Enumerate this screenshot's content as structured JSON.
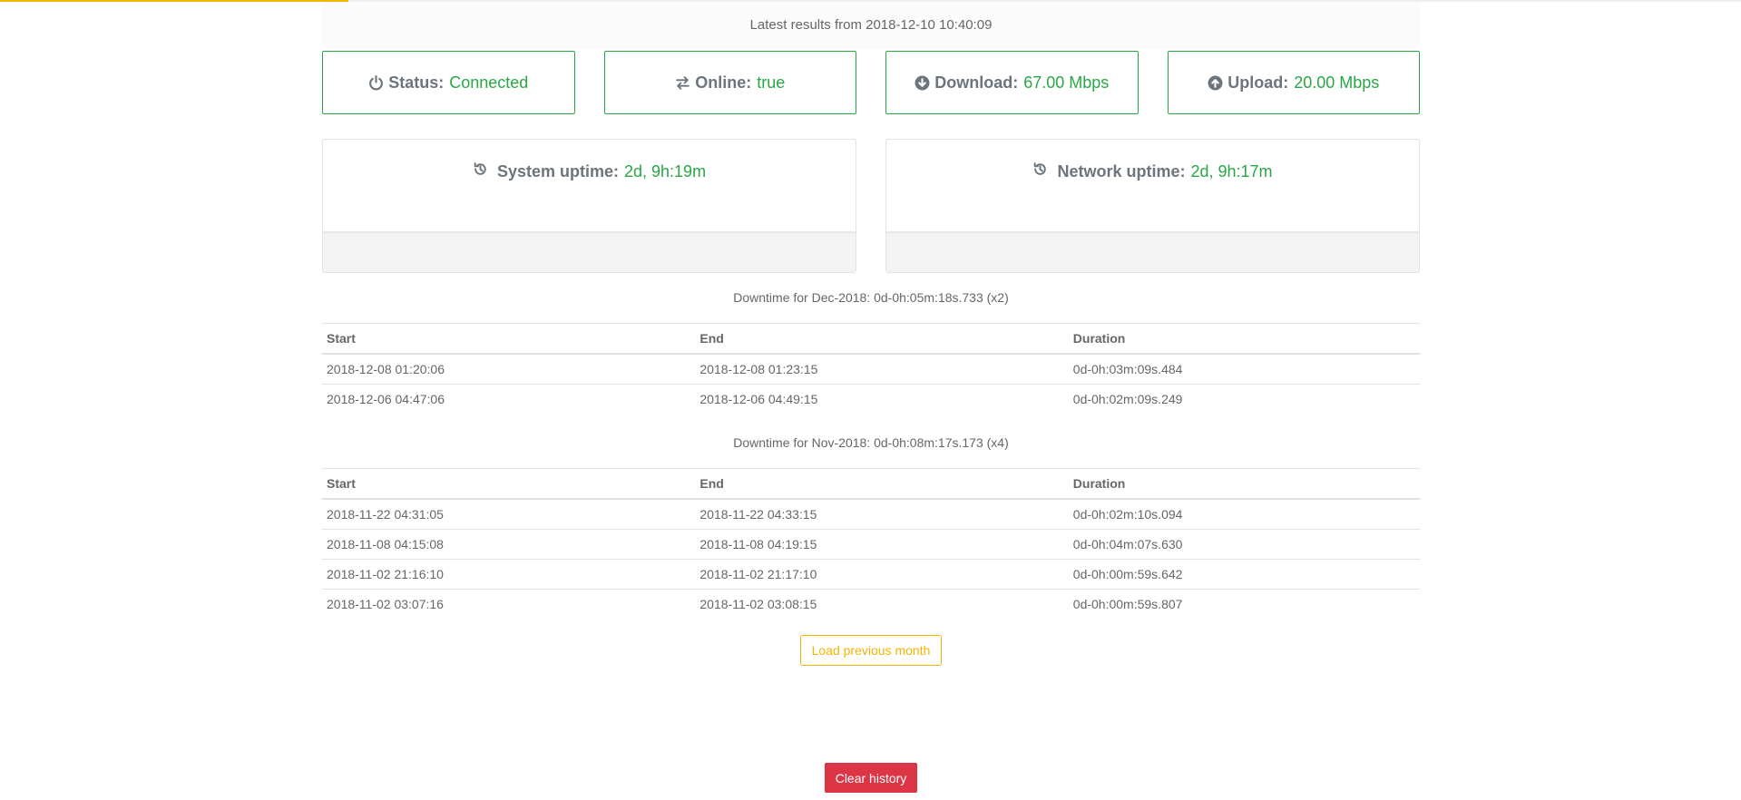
{
  "progress": {
    "percent": 20,
    "color": "#f5b400"
  },
  "latest": "Latest results from 2018-12-10 10:40:09",
  "status_cards": [
    {
      "icon": "power-icon",
      "label": "Status:",
      "value": "Connected"
    },
    {
      "icon": "exchange-icon",
      "label": "Online:",
      "value": "true"
    },
    {
      "icon": "download-icon",
      "label": "Download:",
      "value": "67.00 Mbps"
    },
    {
      "icon": "upload-icon",
      "label": "Upload:",
      "value": "20.00 Mbps"
    }
  ],
  "uptimes": [
    {
      "icon": "history-icon",
      "label": "System uptime:",
      "value": "2d, 9h:19m"
    },
    {
      "icon": "history-icon",
      "label": "Network uptime:",
      "value": "2d, 9h:17m"
    }
  ],
  "months": [
    {
      "summary": "Downtime for Dec-2018: 0d-0h:05m:18s.733 (x2)",
      "columns": [
        "Start",
        "End",
        "Duration"
      ],
      "rows": [
        [
          "2018-12-08 01:20:06",
          "2018-12-08 01:23:15",
          "0d-0h:03m:09s.484"
        ],
        [
          "2018-12-06 04:47:06",
          "2018-12-06 04:49:15",
          "0d-0h:02m:09s.249"
        ]
      ]
    },
    {
      "summary": "Downtime for Nov-2018: 0d-0h:08m:17s.173 (x4)",
      "columns": [
        "Start",
        "End",
        "Duration"
      ],
      "rows": [
        [
          "2018-11-22 04:31:05",
          "2018-11-22 04:33:15",
          "0d-0h:02m:10s.094"
        ],
        [
          "2018-11-08 04:15:08",
          "2018-11-08 04:19:15",
          "0d-0h:04m:07s.630"
        ],
        [
          "2018-11-02 21:16:10",
          "2018-11-02 21:17:10",
          "0d-0h:00m:59s.642"
        ],
        [
          "2018-11-02 03:07:16",
          "2018-11-02 03:08:15",
          "0d-0h:00m:59s.807"
        ]
      ]
    }
  ],
  "buttons": {
    "load_previous": "Load previous month",
    "clear_history": "Clear history"
  },
  "colors": {
    "success": "#28a745",
    "warning": "#f5b400",
    "danger": "#dc3545",
    "label": "#6c757d"
  }
}
